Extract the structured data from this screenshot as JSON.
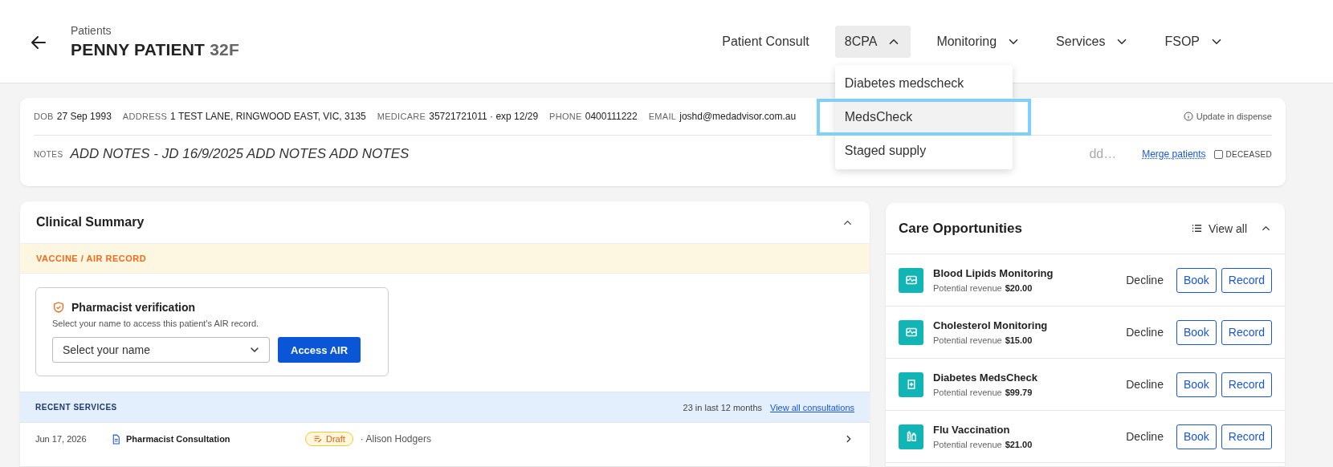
{
  "header": {
    "breadcrumb": "Patients",
    "name": "PENNY PATIENT",
    "age_sex": "32F"
  },
  "nav": [
    {
      "label": "Patient Consult",
      "kind": "link",
      "expanded": false
    },
    {
      "label": "8CPA",
      "kind": "menu",
      "expanded": true
    },
    {
      "label": "Monitoring",
      "kind": "menu",
      "expanded": false
    },
    {
      "label": "Services",
      "kind": "menu",
      "expanded": false
    },
    {
      "label": "FSOP",
      "kind": "menu",
      "expanded": false
    }
  ],
  "dropdown": {
    "items": [
      {
        "label": "Diabetes medscheck",
        "selected": false,
        "annotated": false
      },
      {
        "label": "MedsCheck",
        "selected": true,
        "annotated": true
      },
      {
        "label": "Staged supply",
        "selected": false,
        "annotated": false
      }
    ]
  },
  "patient": {
    "fields": [
      {
        "label": "DOB",
        "value": "27 Sep 1993"
      },
      {
        "label": "ADDRESS",
        "value": "1 TEST LANE, RINGWOOD EAST, VIC, 3135"
      },
      {
        "label": "MEDICARE",
        "value": "35721721011 · exp 12/29"
      },
      {
        "label": "PHONE",
        "value": "0400111222"
      },
      {
        "label": "EMAIL",
        "value": "joshd@medadvisor.com.au"
      }
    ],
    "update_link": "Update in dispense",
    "notes_label": "NOTES",
    "notes": "ADD NOTES - JD 16/9/2025 ADD NOTES ADD NOTES",
    "notes_hint": "dd…",
    "merge_link": "Merge patients",
    "deceased": {
      "label": "DECEASED",
      "checked": false
    }
  },
  "clinical": {
    "title": "Clinical Summary",
    "expanded": true,
    "vaccine_title": "VACCINE / AIR RECORD",
    "verification": {
      "title": "Pharmacist verification",
      "hint": "Select your name to access this patient's AIR record.",
      "placeholder": "Select your name",
      "button": "Access AIR"
    },
    "recent": {
      "title": "RECENT SERVICES",
      "count": "23 in last 12 months",
      "link": "View all consultations",
      "rows": [
        {
          "date": "Jun 17, 2026",
          "service": "Pharmacist Consultation",
          "status": "Draft",
          "by": "· Alison Hodgers"
        }
      ]
    }
  },
  "care": {
    "title": "Care Opportunities",
    "view_all": "View all",
    "expanded": true,
    "items": [
      {
        "name": "Blood Lipids Monitoring",
        "revenue_label": "Potential revenue",
        "revenue": "$20.00",
        "kind": "monitor",
        "decline": "Decline",
        "book": "Book",
        "record": "Record"
      },
      {
        "name": "Cholesterol Monitoring",
        "revenue_label": "Potential revenue",
        "revenue": "$15.00",
        "kind": "monitor",
        "decline": "Decline",
        "book": "Book",
        "record": "Record"
      },
      {
        "name": "Diabetes MedsCheck",
        "revenue_label": "Potential revenue",
        "revenue": "$99.79",
        "kind": "meds",
        "decline": "Decline",
        "book": "Book",
        "record": "Record"
      },
      {
        "name": "Flu Vaccination",
        "revenue_label": "Potential revenue",
        "revenue": "$21.00",
        "kind": "vaccine",
        "decline": "Decline",
        "book": "Book",
        "record": "Record"
      }
    ]
  }
}
